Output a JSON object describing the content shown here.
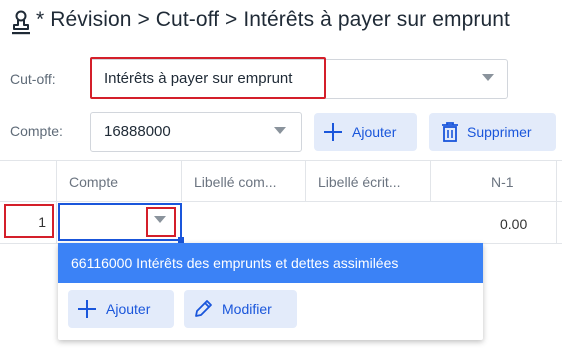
{
  "header": {
    "title": "* Révision > Cut-off > Intérêts à payer sur emprunt",
    "icon": "stamp-icon"
  },
  "filters": {
    "cutoff_label": "Cut-off:",
    "cutoff_value": "Intérêts à payer sur emprunt",
    "compte_label": "Compte:",
    "compte_value": "16888000",
    "add_label": "Ajouter",
    "delete_label": "Supprimer"
  },
  "table": {
    "columns": [
      "Compte",
      "Libellé com...",
      "Libellé écrit...",
      "N-1"
    ],
    "rows": [
      {
        "num": "1",
        "compte": "",
        "n1": "0.00"
      }
    ]
  },
  "dropdown": {
    "option": "66116000 Intérêts des emprunts et dettes assimilées",
    "add_label": "Ajouter",
    "edit_label": "Modifier"
  },
  "colors": {
    "accent": "#1a56db",
    "highlight": "#d41f2a",
    "option_bg": "#3b82f6",
    "button_bg": "#e3ebfa"
  }
}
